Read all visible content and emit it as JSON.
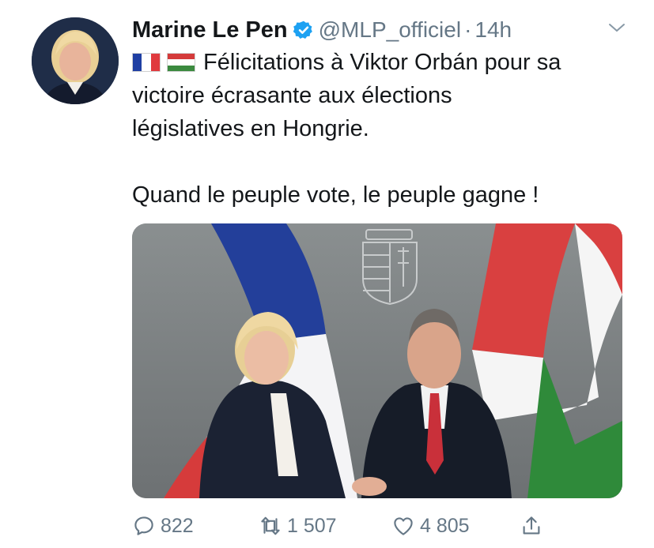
{
  "tweet": {
    "author_name": "Marine Le Pen",
    "handle": "@MLP_officiel",
    "separator": "·",
    "time": "14h",
    "text_line1": "Félicitations à Viktor Orbán pour sa",
    "text_line2": "victoire écrasante aux élections",
    "text_line3": "législatives en Hongrie.",
    "text_line5": "Quand le peuple vote, le peuple gagne !",
    "flags": [
      "france-flag",
      "hungary-flag"
    ]
  },
  "actions": {
    "replies": "822",
    "retweets": "1 507",
    "likes": "4 805"
  },
  "colors": {
    "text": "#14171a",
    "muted": "#657786",
    "verified": "#1da1f2",
    "france_blue": "#1f3fa3",
    "france_red": "#e03a3e",
    "hungary_red": "#d43a3a",
    "hungary_green": "#3b8a3f"
  }
}
